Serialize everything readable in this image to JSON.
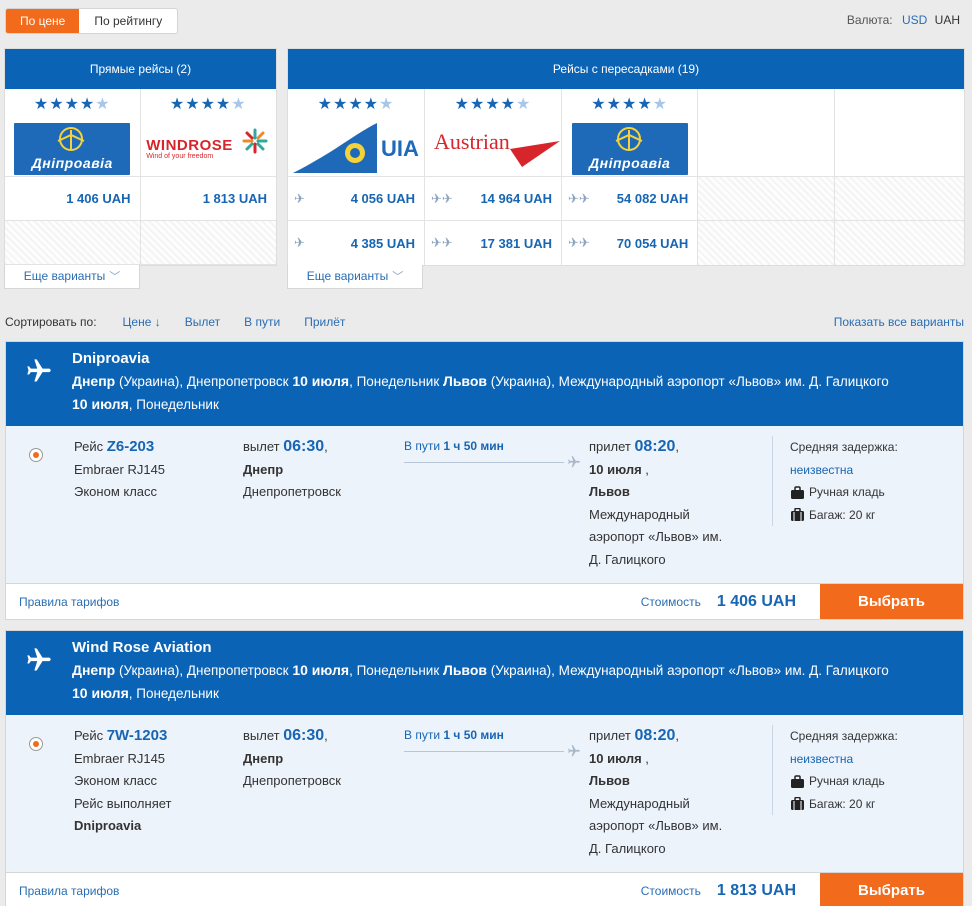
{
  "topbar": {
    "sort_options": [
      "По цене",
      "По рейтингу"
    ],
    "currency_label": "Валюта:",
    "currency_usd": "USD",
    "currency_uah": "UAH"
  },
  "matrix": {
    "direct_header": "Прямые рейсы (2)",
    "connect_header": "Рейсы с пересадками (19)",
    "direct": [
      {
        "logo": "Днiпроавiа",
        "rating": 4,
        "prices": [
          "1 406 UAH"
        ]
      },
      {
        "logo": "WINDROSE",
        "logo_sub": "Wind of your freedom",
        "rating": 4,
        "prices": [
          "1 813 UAH"
        ]
      }
    ],
    "connect": [
      {
        "logo": "UIA",
        "rating": 4,
        "prices": [
          "4 056 UAH",
          "4 385 UAH"
        ],
        "stops": [
          "✈",
          "✈"
        ]
      },
      {
        "logo": "Austrian",
        "rating": 4,
        "prices": [
          "14 964 UAH",
          "17 381 UAH"
        ],
        "stops": [
          "✈✈",
          "✈✈"
        ]
      },
      {
        "logo": "Днiпроавiа",
        "rating": 4,
        "prices": [
          "54 082 UAH",
          "70 054 UAH"
        ],
        "stops": [
          "✈✈",
          "✈✈"
        ]
      }
    ],
    "more_label": "Еще варианты"
  },
  "sortbar": {
    "label": "Сортировать по:",
    "options": [
      "Цене ↓",
      "Вылет",
      "В пути",
      "Прилёт"
    ],
    "show_all": "Показать все варианты"
  },
  "flights": [
    {
      "airline": "Dniproavia",
      "route_from_city": "Днепр",
      "route_from_rest": "(Украина), Днепропетровск",
      "route_date": "10 июля",
      "route_day": ", Понедельник",
      "route_to_city": "Львов",
      "route_to_rest": "(Украина), Международный аэропорт «Львов» им. Д. Галицкого",
      "route_date2": "10 июля",
      "route_day2": ", Понедельник",
      "flight_label": "Рейс",
      "flight_number": "Z6-203",
      "aircraft": "Embraer RJ145",
      "cabin": "Эконом класс",
      "operated_label": "",
      "operated_by": "",
      "dep_label": "вылет",
      "dep_time": "06:30",
      "dep_city": "Днепр",
      "dep_airport": "Днепропетровск",
      "dur_label": "В пути",
      "dur_value": "1 ч 50 мин",
      "arr_label": "прилет",
      "arr_time": "08:20",
      "arr_date": "10 июля",
      "arr_city": "Львов",
      "arr_airport_1": "Международный",
      "arr_airport_2": "аэропорт «Львов» им.",
      "arr_airport_3": "Д. Галицкого",
      "delay_label": "Средняя задержка:",
      "delay_value": "неизвестна",
      "hand_bag": "Ручная кладь",
      "baggage": "Багаж: 20 кг",
      "rules": "Правила тарифов",
      "cost_label": "Стоимость",
      "cost": "1 406 UAH",
      "choose": "Выбрать"
    },
    {
      "airline": "Wind Rose Aviation",
      "route_from_city": "Днепр",
      "route_from_rest": "(Украина), Днепропетровск",
      "route_date": "10 июля",
      "route_day": ", Понедельник",
      "route_to_city": "Львов",
      "route_to_rest": "(Украина), Международный аэропорт «Львов» им. Д. Галицкого",
      "route_date2": "10 июля",
      "route_day2": ", Понедельник",
      "flight_label": "Рейс",
      "flight_number": "7W-1203",
      "aircraft": "Embraer RJ145",
      "cabin": "Эконом класс",
      "operated_label": "Рейс выполняет",
      "operated_by": "Dniproavia",
      "dep_label": "вылет",
      "dep_time": "06:30",
      "dep_city": "Днепр",
      "dep_airport": "Днепропетровск",
      "dur_label": "В пути",
      "dur_value": "1 ч 50 мин",
      "arr_label": "прилет",
      "arr_time": "08:20",
      "arr_date": "10 июля",
      "arr_city": "Львов",
      "arr_airport_1": "Международный",
      "arr_airport_2": "аэропорт «Львов» им.",
      "arr_airport_3": "Д. Галицкого",
      "delay_label": "Средняя задержка:",
      "delay_value": "неизвестна",
      "hand_bag": "Ручная кладь",
      "baggage": "Багаж: 20 кг",
      "rules": "Правила тарифов",
      "cost_label": "Стоимость",
      "cost": "1 813 UAH",
      "choose": "Выбрать"
    }
  ]
}
